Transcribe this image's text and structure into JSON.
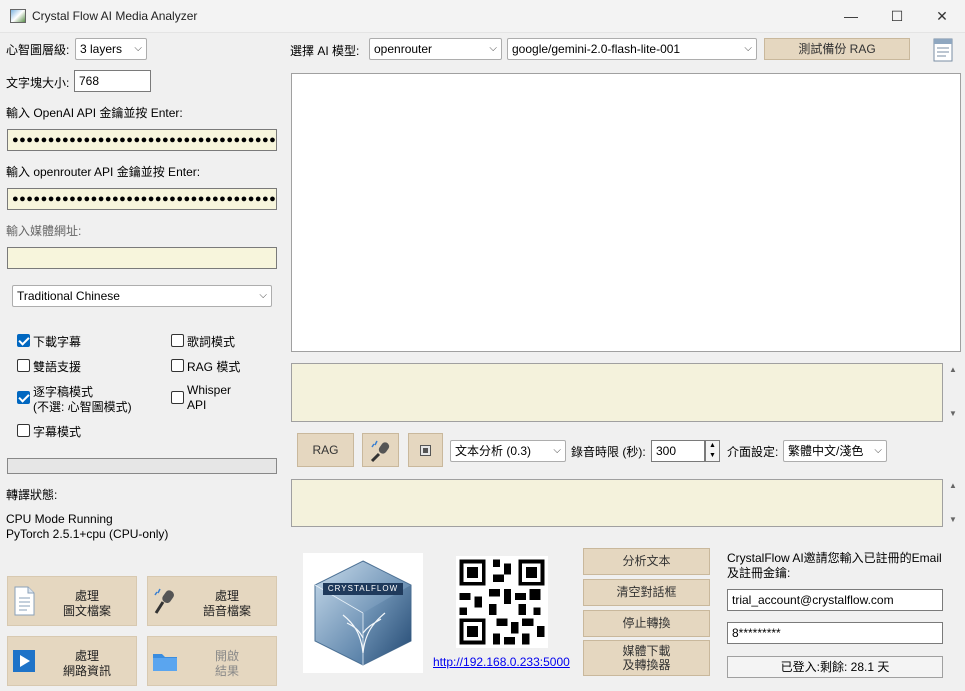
{
  "window": {
    "title": "Crystal Flow AI Media Analyzer",
    "minimize": "—",
    "maximize": "☐",
    "close": "✕"
  },
  "left": {
    "mindmap_level_label": "心智圖層級:",
    "mindmap_level_value": "3 layers",
    "chunk_size_label": "文字塊大小:",
    "chunk_size_value": "768",
    "openai_key_label": "輸入 OpenAI API 金鑰並按 Enter:",
    "openai_key_value": "●●●●●●●●●●●●●●●●●●●●●●●●●●●●●●●●●●●●●●●●●●●●●●",
    "openrouter_key_label": "輸入 openrouter API 金鑰並按 Enter:",
    "openrouter_key_value": "●●●●●●●●●●●●●●●●●●●●●●●●●●●●●●●●●●●●●●●●●●●●●●",
    "media_url_label": "輸入媒體網址:",
    "media_url_value": "",
    "language_value": "Traditional Chinese",
    "checkboxes": [
      {
        "label": "下載字幕",
        "checked": true
      },
      {
        "label": "歌詞模式",
        "checked": false
      },
      {
        "label": "雙語支援",
        "checked": false
      },
      {
        "label": "RAG 模式",
        "checked": false
      },
      {
        "label": "逐字稿模式",
        "label2": "(不選: 心智圖模式)",
        "checked": true
      },
      {
        "label": "Whisper",
        "label2": "API",
        "checked": false
      },
      {
        "label": "字幕模式",
        "checked": false
      }
    ],
    "progress": 0,
    "transcribe_status_label": "轉譯狀態:",
    "status_line1": "CPU Mode Running",
    "status_line2": "PyTorch 2.5.1+cpu (CPU-only)",
    "tiles": [
      {
        "line1": "處理",
        "line2": "圖文檔案",
        "icon": "document-icon"
      },
      {
        "line1": "處理",
        "line2": "語音檔案",
        "icon": "microphone-icon"
      },
      {
        "line1": "處理",
        "line2": "網路資訊",
        "icon": "play-icon"
      },
      {
        "line1": "開啟",
        "line2": "結果",
        "icon": "folder-icon"
      }
    ]
  },
  "right": {
    "model_label": "選擇 AI 模型:",
    "provider_value": "openrouter",
    "model_value": "google/gemini-2.0-flash-lite-001",
    "test_rag_button": "測試備份 RAG",
    "rag_button": "RAG",
    "analysis_select_value": "文本分析 (0.3)",
    "record_limit_label": "錄音時限 (秒):",
    "record_limit_value": "300",
    "ui_setting_label": "介面設定:",
    "ui_setting_value": "繁體中文/淺色",
    "qr_link": "http://192.168.0.233:5000",
    "logo_text": "CRYSTALFLOW",
    "actions": [
      "分析文本",
      "清空對話框",
      "停止轉換",
      "媒體下載",
      "及轉換器"
    ],
    "login_prompt_line1": "CrystalFlow AI邀請您輸入已註冊的Email",
    "login_prompt_line2": "及註冊金鑰:",
    "email_value": "trial_account@crystalflow.com",
    "key_value": "8*********",
    "login_status": "已登入:剩餘: 28.1 天"
  },
  "colors": {
    "tan": "#e5d7c0",
    "cream": "#f7f5dc",
    "accent": "#0067c0"
  }
}
